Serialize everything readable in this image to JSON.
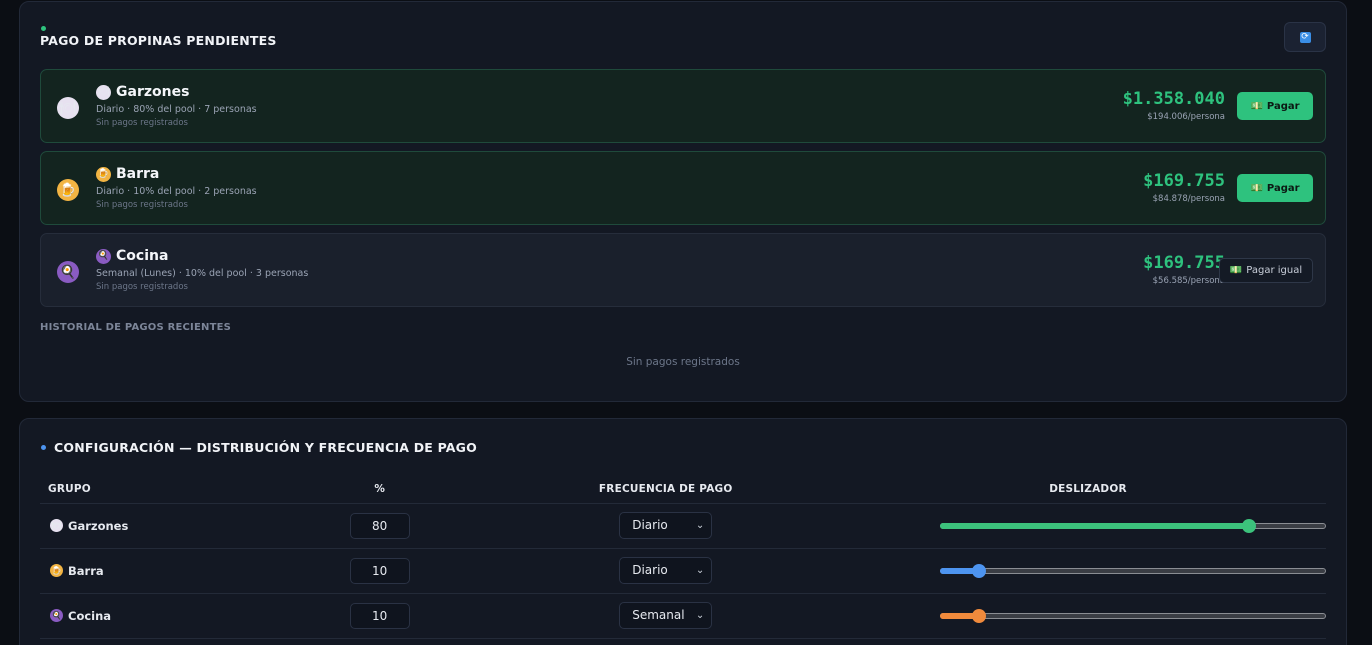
{
  "pending": {
    "title": "PAGO DE PROPINAS PENDIENTES",
    "refresh_icon": "refresh-icon",
    "groups": [
      {
        "icon": "🍽",
        "name": "Garzones",
        "desc": "Diario · 80% del pool · 7 personas",
        "history": "Sin pagos registrados",
        "amount": "$1.358.040",
        "per_person": "$194.006/persona",
        "button": "Pagar"
      },
      {
        "icon": "🍺",
        "name": "Barra",
        "desc": "Diario · 10% del pool · 2 personas",
        "history": "Sin pagos registrados",
        "amount": "$169.755",
        "per_person": "$84.878/persona",
        "button": "Pagar"
      },
      {
        "icon": "🍳",
        "name": "Cocina",
        "desc": "Semanal (Lunes) · 10% del pool · 3 personas",
        "history": "Sin pagos registrados",
        "amount": "$169.755",
        "per_person": "$56.585/persona",
        "button": "Pagar igual"
      }
    ],
    "history_title": "HISTORIAL DE PAGOS RECIENTES",
    "history_empty": "Sin pagos registrados"
  },
  "config": {
    "title": "CONFIGURACIÓN — DISTRIBUCIÓN Y FRECUENCIA DE PAGO",
    "headers": [
      "GRUPO",
      "%",
      "FRECUENCIA DE PAGO",
      "DESLIZADOR"
    ],
    "rows": [
      {
        "icon": "🍽",
        "name": "Garzones",
        "pct": "80",
        "freq": "Diario",
        "slider": 80,
        "color": "#3cc27c"
      },
      {
        "icon": "🍺",
        "name": "Barra",
        "pct": "10",
        "freq": "Diario",
        "slider": 10,
        "color": "#4d94f0"
      },
      {
        "icon": "🍳",
        "name": "Cocina",
        "pct": "10",
        "freq": "Semanal",
        "slider": 10,
        "color": "#f08a3c"
      }
    ]
  },
  "colors": {
    "accent_green": "#2ec27e",
    "accent_blue": "#3a8ee6"
  }
}
